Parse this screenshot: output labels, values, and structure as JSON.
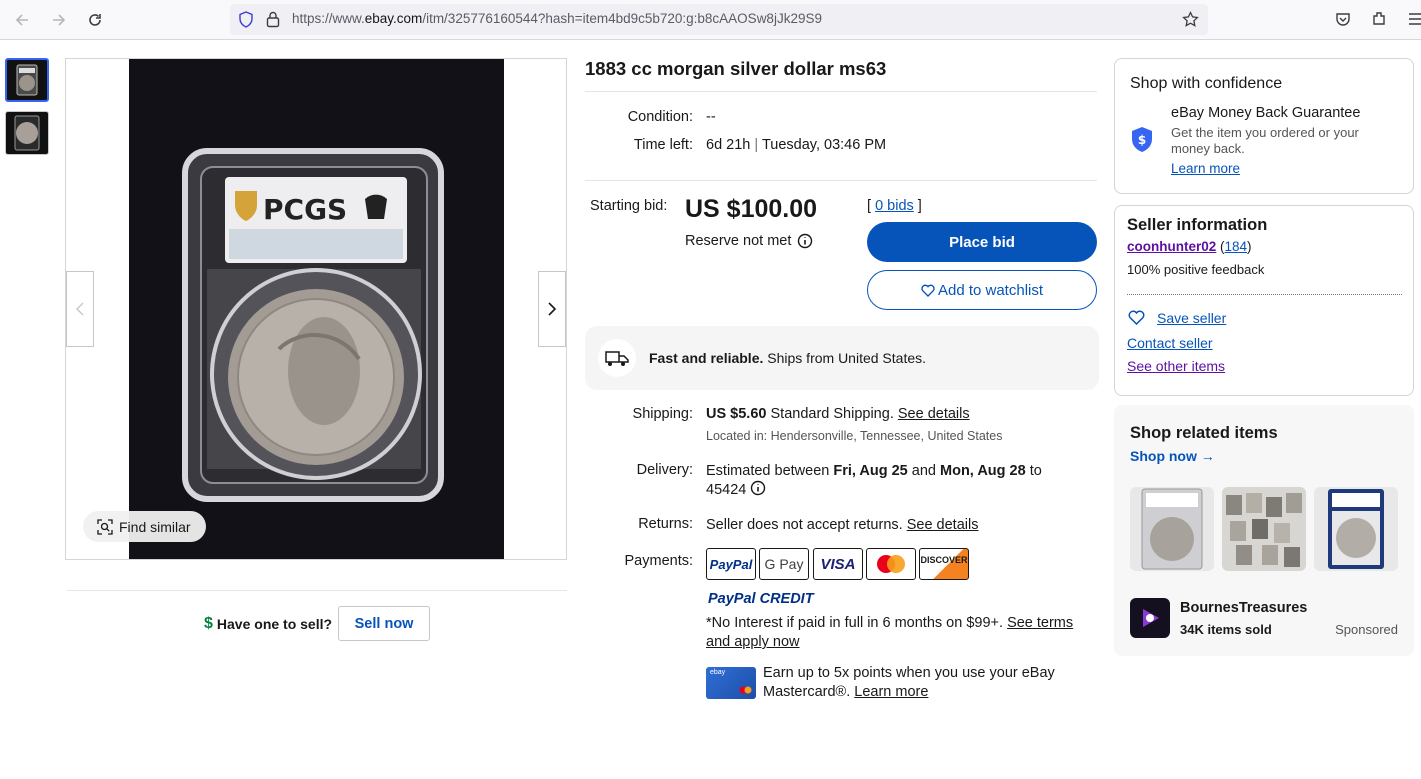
{
  "browser": {
    "url_prefix": "https://www.",
    "url_domain": "ebay.com",
    "url_path": "/itm/325776160544?hash=item4bd9c5b720:g:b8cAAOSw8jJk29S9"
  },
  "gallery": {
    "find_similar_label": "Find similar",
    "have_one_label": "Have one to sell?",
    "sell_now_label": "Sell now"
  },
  "listing": {
    "title": "1883 cc morgan silver dollar ms63",
    "condition_label": "Condition:",
    "condition_value": "--",
    "time_left_label": "Time left:",
    "time_left_value": "6d 21h",
    "time_left_date": "Tuesday, 03:46 PM",
    "starting_bid_label": "Starting bid:",
    "price": "US $100.00",
    "reserve_text": "Reserve not met",
    "bids_open": "[",
    "bids_link": "0 bids",
    "bids_close": "]",
    "place_bid_label": "Place bid",
    "watchlist_label": "Add to watchlist",
    "fast_bold": "Fast and reliable.",
    "fast_rest": "Ships from United States.",
    "shipping_label": "Shipping:",
    "shipping_price": "US $5.60",
    "shipping_method": "Standard Shipping.",
    "shipping_details_link": "See details",
    "located_in": "Located in: Hendersonville, Tennessee, United States",
    "delivery_label": "Delivery:",
    "delivery_pre": "Estimated between",
    "delivery_from": "Fri, Aug 25",
    "delivery_and": "and",
    "delivery_to": "Mon, Aug 28",
    "delivery_post": "to",
    "delivery_zip": "45424",
    "returns_label": "Returns:",
    "returns_value": "Seller does not accept returns.",
    "returns_link": "See details",
    "payments_label": "Payments:",
    "payment_methods": [
      "PayPal",
      "G Pay",
      "VISA",
      "Mastercard",
      "DISCOVER"
    ],
    "paypal_credit": "PayPal CREDIT",
    "credit_text": "*No Interest if paid in full in 6 months on $99+.",
    "credit_link_1": "See terms",
    "credit_link_2": "and apply now",
    "points_line1": "Earn up to 5x points when you use your eBay",
    "points_line2": "Mastercard®.",
    "points_link": "Learn more"
  },
  "confidence": {
    "title": "Shop with confidence",
    "guarantee_title": "eBay Money Back Guarantee",
    "guarantee_line1": "Get the item you ordered or your",
    "guarantee_line2": "money back.",
    "learn_more": "Learn more"
  },
  "seller": {
    "title": "Seller information",
    "name": "coonhunter02",
    "score": "184",
    "feedback": "100% positive feedback",
    "save_seller": "Save seller",
    "contact_seller": "Contact seller",
    "see_other": "See other items"
  },
  "related": {
    "title": "Shop related items",
    "shop_now": "Shop now",
    "store_name": "BournesTreasures",
    "items_sold": "34K items sold",
    "sponsored": "Sponsored"
  },
  "colors": {
    "ebay_blue": "#0654ba",
    "link_purple": "#5e0fa4"
  }
}
